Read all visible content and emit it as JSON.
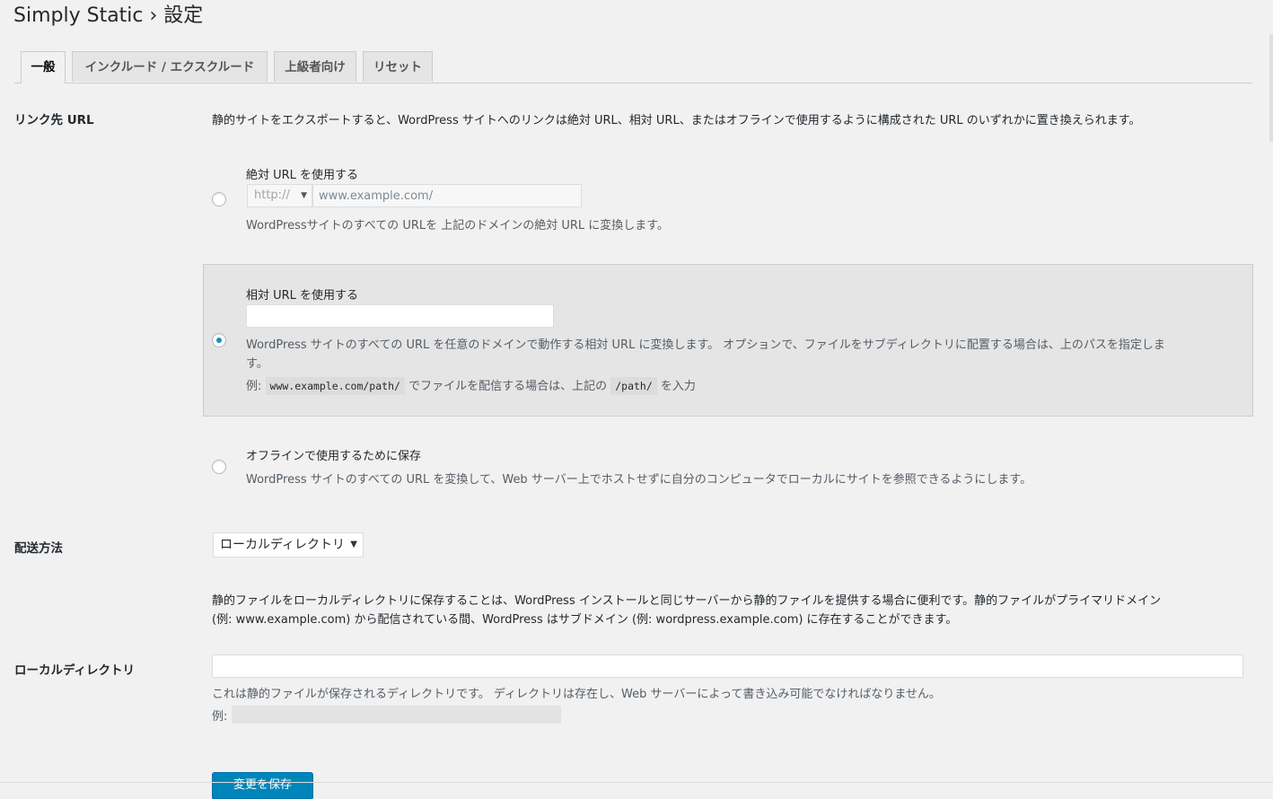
{
  "page": {
    "title": "Simply Static › 設定"
  },
  "tabs": [
    {
      "label": "一般",
      "active": true
    },
    {
      "label": "インクルード / エクスクルード",
      "active": false
    },
    {
      "label": "上級者向け",
      "active": false
    },
    {
      "label": "リセット",
      "active": false
    }
  ],
  "link_url": {
    "heading": "リンク先 URL",
    "intro": "静的サイトをエクスポートすると、WordPress サイトへのリンクは絶対 URL、相対 URL、またはオフラインで使用するように構成された URL のいずれかに置き換えられます。",
    "absolute": {
      "label": "絶対 URL を使用する",
      "protocol": "http://",
      "host_placeholder": "www.example.com/",
      "desc": "WordPressサイトのすべての URLを 上記のドメインの絶対 URL に変換します。"
    },
    "relative": {
      "label": "相対 URL を使用する",
      "value": "",
      "desc_line1": "WordPress サイトのすべての URL を任意のドメインで動作する相対 URL に変換します。 オプションで、ファイルをサブディレクトリに配置する場合は、上のパスを指定しま",
      "desc_line2": "す。",
      "example_prefix": "例:",
      "example_code1": "www.example.com/path/",
      "example_mid": "でファイルを配信する場合は、上記の",
      "example_code2": "/path/",
      "example_suffix": "を入力"
    },
    "offline": {
      "label": "オフラインで使用するために保存",
      "desc": "WordPress サイトのすべての URL を変換して、Web サーバー上でホストせずに自分のコンピュータでローカルにサイトを参照できるようにします。"
    },
    "selected": "relative"
  },
  "delivery": {
    "heading": "配送方法",
    "selected": "ローカルディレクトリ",
    "desc_line1": "静的ファイルをローカルディレクトリに保存することは、WordPress インストールと同じサーバーから静的ファイルを提供する場合に便利です。静的ファイルがプライマリドメイン",
    "desc_line2": "(例: www.example.com) から配信されている間、WordPress はサブドメイン (例: wordpress.example.com) に存在することができます。"
  },
  "local_dir": {
    "heading": "ローカルディレクトリ",
    "value": "",
    "desc": "これは静的ファイルが保存されるディレクトリです。 ディレクトリは存在し、Web サーバーによって書き込み可能でなければなりません。",
    "example_prefix": "例:"
  },
  "submit": {
    "label": "変更を保存"
  },
  "colors": {
    "accent": "#0085ba",
    "background": "#f1f1f1",
    "selected_row": "#e5e5e5"
  }
}
